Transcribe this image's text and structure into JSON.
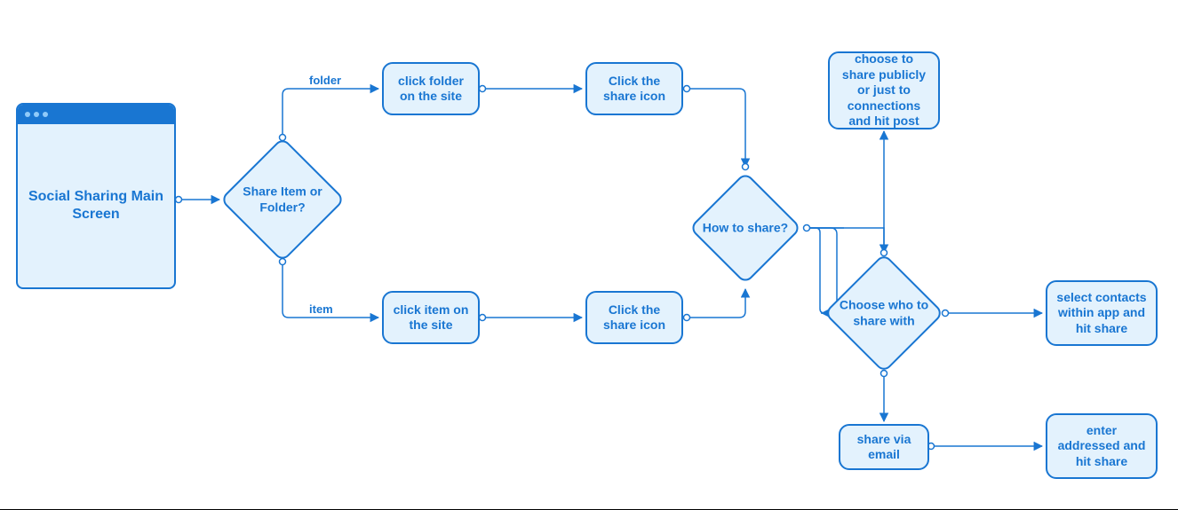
{
  "colors": {
    "accent": "#1976d2",
    "fill": "#e3f2fd"
  },
  "start": {
    "title": "Social Sharing Main Screen"
  },
  "decisions": {
    "share_type": "Share Item or Folder?",
    "how_share": "How to share?",
    "who_share": "Choose who to share with"
  },
  "edge_labels": {
    "folder": "folder",
    "item": "item"
  },
  "boxes": {
    "click_folder": "click folder on the site",
    "click_item": "click item on the site",
    "share_icon_top": "Click the share icon",
    "share_icon_bottom": "Click the share icon",
    "public_post": "choose to share publicly or just to connections and hit post",
    "select_contacts": "select contacts within app and hit share",
    "share_email": "share via email",
    "enter_address": "enter addressed and hit share"
  }
}
